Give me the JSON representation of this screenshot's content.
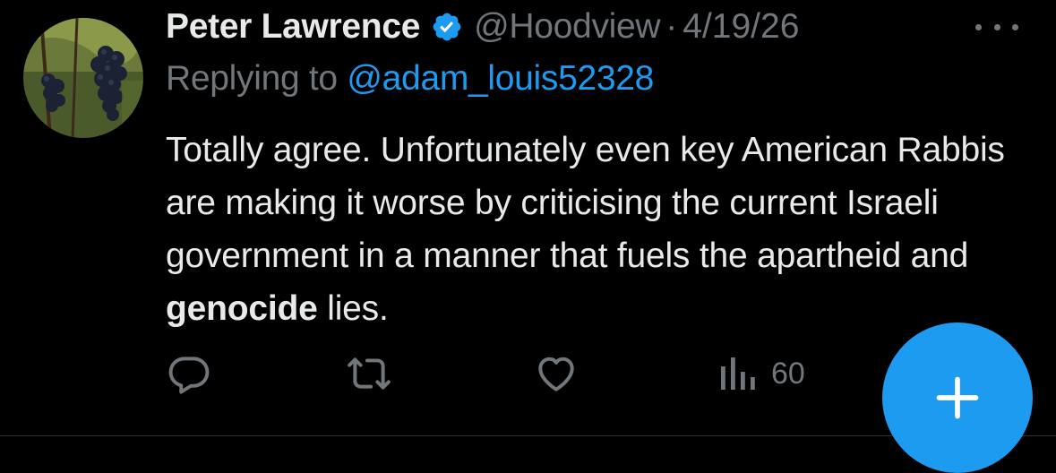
{
  "tweet": {
    "display_name": "Peter Lawrence",
    "handle": "@Hoodview",
    "separator": "·",
    "date": "4/19/26",
    "replying_prefix": "Replying to",
    "replying_handle": "@adam_louis52328",
    "text_before": "Totally agree. Unfortunately even key American Rabbis are making it worse by criticising the current Israeli government in a manner that fuels the apartheid and ",
    "text_bold": "genocide",
    "text_after": " lies.",
    "verified": true,
    "avatar": "grape-vine-photo"
  },
  "actions": {
    "reply_icon": "reply-icon",
    "retweet_icon": "retweet-icon",
    "like_icon": "heart-icon",
    "views_icon": "views-icon",
    "views_count": "60"
  },
  "fab": {
    "icon": "plus-icon"
  },
  "colors": {
    "background": "#000000",
    "text": "#e7e9ea",
    "secondary": "#71767b",
    "accent": "#1d9bf0",
    "divider": "#2f3336"
  }
}
